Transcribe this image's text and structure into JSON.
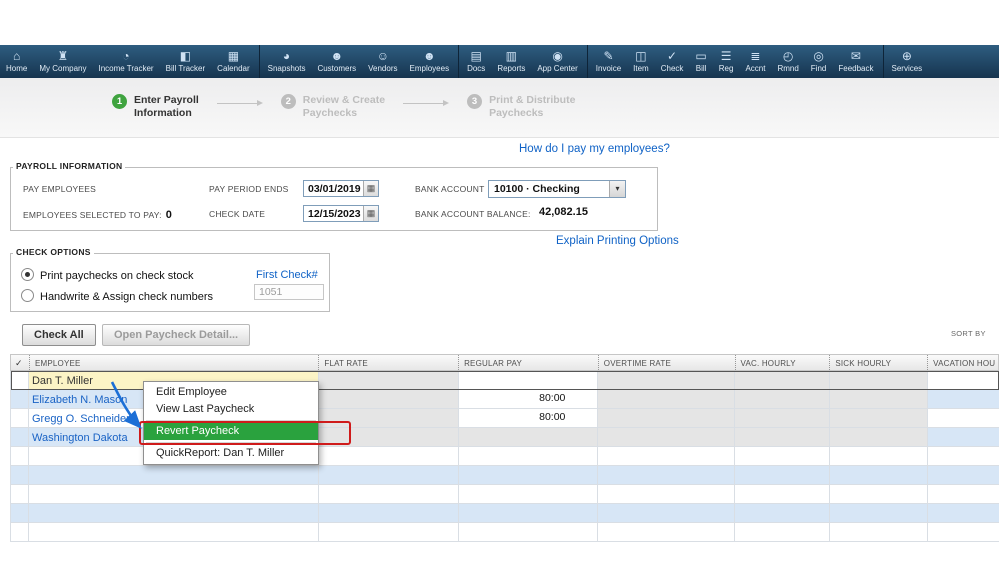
{
  "colors": {
    "highlight_green": "#2aa23e",
    "annotation_red": "#cf1b1b",
    "annotation_blue": "#1c6fd6",
    "link_blue": "#0f62c6"
  },
  "icons": {
    "calendar": "▦",
    "dropdown": "▾"
  },
  "toolbar": {
    "items": [
      {
        "label": "Home",
        "glyph": "⌂"
      },
      {
        "label": "My Company",
        "glyph": "♜"
      },
      {
        "label": "Income Tracker",
        "glyph": "◔"
      },
      {
        "label": "Bill Tracker",
        "glyph": "◧"
      },
      {
        "label": "Calendar",
        "glyph": "▦",
        "sep_after": true
      },
      {
        "label": "Snapshots",
        "glyph": "◕"
      },
      {
        "label": "Customers",
        "glyph": "☻"
      },
      {
        "label": "Vendors",
        "glyph": "☺"
      },
      {
        "label": "Employees",
        "glyph": "☻",
        "sep_after": true
      },
      {
        "label": "Docs",
        "glyph": "▤"
      },
      {
        "label": "Reports",
        "glyph": "▥"
      },
      {
        "label": "App Center",
        "glyph": "◉",
        "sep_after": true
      },
      {
        "label": "Invoice",
        "glyph": "✎"
      },
      {
        "label": "Item",
        "glyph": "◫"
      },
      {
        "label": "Check",
        "glyph": "✓"
      },
      {
        "label": "Bill",
        "glyph": "▭"
      },
      {
        "label": "Reg",
        "glyph": "☰"
      },
      {
        "label": "Accnt",
        "glyph": "≣"
      },
      {
        "label": "Rmnd",
        "glyph": "◴"
      },
      {
        "label": "Find",
        "glyph": "◎"
      },
      {
        "label": "Feedback",
        "glyph": "✉",
        "sep_after": true
      },
      {
        "label": "Services",
        "glyph": "⊕"
      }
    ]
  },
  "steps": {
    "items": [
      {
        "num": "1",
        "line1": "Enter Payroll",
        "line2": "Information",
        "state": "active"
      },
      {
        "num": "2",
        "line1": "Review & Create",
        "line2": "Paychecks",
        "state": "inactive"
      },
      {
        "num": "3",
        "line1": "Print & Distribute",
        "line2": "Paychecks",
        "state": "inactive"
      }
    ]
  },
  "links": {
    "help": "How do I pay my employees?",
    "explain": "Explain Printing Options"
  },
  "payroll_info": {
    "legend": "PAYROLL INFORMATION",
    "pay_employees_label": "PAY EMPLOYEES",
    "selected_label": "EMPLOYEES SELECTED TO PAY:",
    "selected_count": "0",
    "pay_period_label": "PAY PERIOD ENDS",
    "pay_period_value": "03/01/2019",
    "check_date_label": "CHECK DATE",
    "check_date_value": "12/15/2023",
    "bank_account_label": "BANK ACCOUNT",
    "bank_account_value": "10100 · Checking",
    "bank_balance_label": "BANK ACCOUNT BALANCE:",
    "bank_balance_value": "42,082.15"
  },
  "check_options": {
    "legend": "CHECK OPTIONS",
    "option_print": "Print paychecks on check stock",
    "option_handwrite": "Handwrite & Assign check numbers",
    "first_check_label": "First Check#",
    "first_check_value": "1051"
  },
  "actions": {
    "check_all": "Check All",
    "open_detail": "Open Paycheck Detail...",
    "sort_by": "SORT BY"
  },
  "table": {
    "header_check_glyph": "✓",
    "columns": [
      "EMPLOYEE",
      "FLAT RATE",
      "REGULAR PAY",
      "OVERTIME RATE",
      "VAC. HOURLY",
      "SICK HOURLY",
      "VACATION HOU"
    ],
    "rows": [
      {
        "employee": "Dan T. Miller",
        "regular_pay": ""
      },
      {
        "employee": "Elizabeth N. Mason",
        "regular_pay": "80:00"
      },
      {
        "employee": "Gregg O. Schneider",
        "regular_pay": "80:00"
      },
      {
        "employee": "Washington Dakota",
        "regular_pay": ""
      }
    ],
    "empty_rows": 5
  },
  "context_menu": {
    "items": [
      "Edit Employee",
      "View Last Paycheck",
      "Revert Paycheck",
      "QuickReport: Dan T. Miller"
    ],
    "highlight_index": 2,
    "separators_before": [
      2,
      3
    ]
  }
}
